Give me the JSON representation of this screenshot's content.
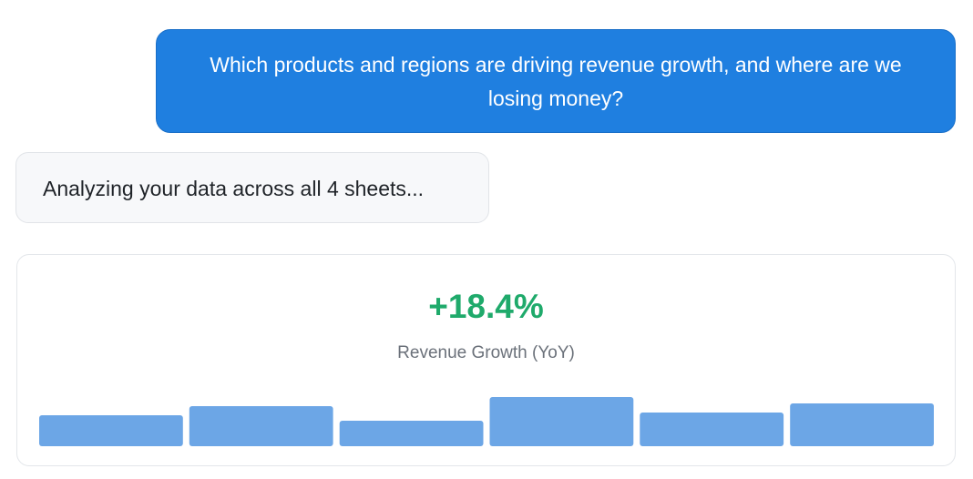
{
  "conversation": {
    "user_message": "Which products and regions are driving revenue growth, and where are we losing money?",
    "assistant_status": "Analyzing your data across all 4 sheets..."
  },
  "metric": {
    "value": "+18.4%",
    "label": "Revenue Growth (YoY)",
    "value_color": "#1faa6b"
  },
  "chart_data": {
    "type": "bar",
    "values": [
      34,
      44,
      28,
      54,
      37,
      47
    ],
    "ylim": [
      0,
      64
    ],
    "bar_color": "#6ca6e6",
    "grid": false
  },
  "colors": {
    "user_bubble": "#1f7fe0",
    "assistant_bubble": "#f7f8fa"
  }
}
